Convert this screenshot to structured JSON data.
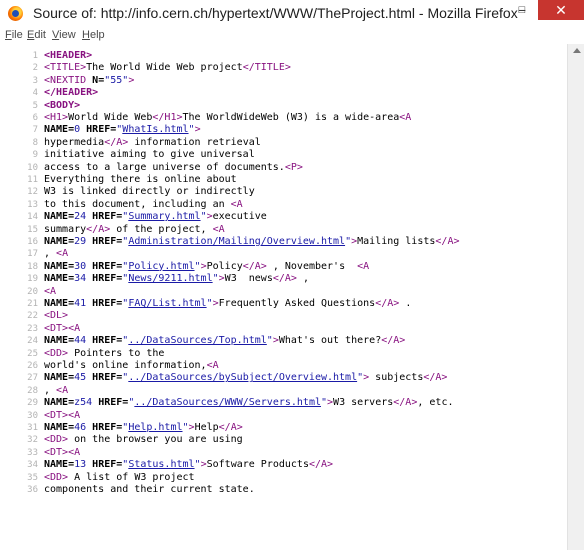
{
  "window": {
    "title": "Source of: http://info.cern.ch/hypertext/WWW/TheProject.html - Mozilla Firefox",
    "minimize": "−",
    "maximize": "□",
    "close": "✕"
  },
  "menu": [
    {
      "label": "File",
      "underline": "F"
    },
    {
      "label": "Edit",
      "underline": "E"
    },
    {
      "label": "View",
      "underline": "V"
    },
    {
      "label": "Help",
      "underline": "H"
    }
  ],
  "lines": [
    [
      [
        "tagb",
        "<HEADER>"
      ]
    ],
    [
      [
        "tag",
        "<TITLE"
      ],
      [
        "tag",
        ">"
      ],
      [
        "t",
        "The World Wide Web project"
      ],
      [
        "tag",
        "</TITLE>"
      ]
    ],
    [
      [
        "tag",
        "<NEXTID "
      ],
      [
        "an",
        "N="
      ],
      [
        "av",
        "\"55\""
      ],
      [
        "tag",
        ">"
      ]
    ],
    [
      [
        "tagb",
        "</HEADER>"
      ]
    ],
    [
      [
        "tagb",
        "<BODY>"
      ]
    ],
    [
      [
        "tag",
        "<H1>"
      ],
      [
        "t",
        "World Wide Web"
      ],
      [
        "tag",
        "</H1>"
      ],
      [
        "t",
        "The WorldWideWeb (W3) is a wide-area"
      ],
      [
        "tag",
        "<A"
      ]
    ],
    [
      [
        "an",
        "NAME="
      ],
      [
        "av",
        "0 "
      ],
      [
        "an",
        "HREF="
      ],
      [
        "av",
        "\""
      ],
      [
        "link",
        "WhatIs.html"
      ],
      [
        "av",
        "\""
      ],
      [
        "tag",
        ">"
      ]
    ],
    [
      [
        "t",
        "hypermedia"
      ],
      [
        "tag",
        "</A>"
      ],
      [
        "t",
        " information retrieval"
      ]
    ],
    [
      [
        "t",
        "initiative aiming to give universal"
      ]
    ],
    [
      [
        "t",
        "access to a large universe of documents."
      ],
      [
        "tag",
        "<P>"
      ]
    ],
    [
      [
        "t",
        "Everything there is online about"
      ]
    ],
    [
      [
        "t",
        "W3 is linked directly or indirectly"
      ]
    ],
    [
      [
        "t",
        "to this document, including an "
      ],
      [
        "tag",
        "<A"
      ]
    ],
    [
      [
        "an",
        "NAME="
      ],
      [
        "av",
        "24 "
      ],
      [
        "an",
        "HREF="
      ],
      [
        "av",
        "\""
      ],
      [
        "link",
        "Summary.html"
      ],
      [
        "av",
        "\""
      ],
      [
        "tag",
        ">"
      ],
      [
        "t",
        "executive"
      ]
    ],
    [
      [
        "t",
        "summary"
      ],
      [
        "tag",
        "</A>"
      ],
      [
        "t",
        " of the project, "
      ],
      [
        "tag",
        "<A"
      ]
    ],
    [
      [
        "an",
        "NAME="
      ],
      [
        "av",
        "29 "
      ],
      [
        "an",
        "HREF="
      ],
      [
        "av",
        "\""
      ],
      [
        "link",
        "Administration/Mailing/Overview.html"
      ],
      [
        "av",
        "\""
      ],
      [
        "tag",
        ">"
      ],
      [
        "t",
        "Mailing lists"
      ],
      [
        "tag",
        "</A>"
      ]
    ],
    [
      [
        "t",
        ", "
      ],
      [
        "tag",
        "<A"
      ]
    ],
    [
      [
        "an",
        "NAME="
      ],
      [
        "av",
        "30 "
      ],
      [
        "an",
        "HREF="
      ],
      [
        "av",
        "\""
      ],
      [
        "link",
        "Policy.html"
      ],
      [
        "av",
        "\""
      ],
      [
        "tag",
        ">"
      ],
      [
        "t",
        "Policy"
      ],
      [
        "tag",
        "</A>"
      ],
      [
        "t",
        " , November's  "
      ],
      [
        "tag",
        "<A"
      ]
    ],
    [
      [
        "an",
        "NAME="
      ],
      [
        "av",
        "34 "
      ],
      [
        "an",
        "HREF="
      ],
      [
        "av",
        "\""
      ],
      [
        "link",
        "News/9211.html"
      ],
      [
        "av",
        "\""
      ],
      [
        "tag",
        ">"
      ],
      [
        "t",
        "W3  news"
      ],
      [
        "tag",
        "</A>"
      ],
      [
        "t",
        " ,"
      ]
    ],
    [
      [
        "tag",
        "<A"
      ]
    ],
    [
      [
        "an",
        "NAME="
      ],
      [
        "av",
        "41 "
      ],
      [
        "an",
        "HREF="
      ],
      [
        "av",
        "\""
      ],
      [
        "link",
        "FAQ/List.html"
      ],
      [
        "av",
        "\""
      ],
      [
        "tag",
        ">"
      ],
      [
        "t",
        "Frequently Asked Questions"
      ],
      [
        "tag",
        "</A>"
      ],
      [
        "t",
        " ."
      ]
    ],
    [
      [
        "tag",
        "<DL>"
      ]
    ],
    [
      [
        "tag",
        "<DT>"
      ],
      [
        "tag",
        "<A"
      ]
    ],
    [
      [
        "an",
        "NAME="
      ],
      [
        "av",
        "44 "
      ],
      [
        "an",
        "HREF="
      ],
      [
        "av",
        "\""
      ],
      [
        "link",
        "../DataSources/Top.html"
      ],
      [
        "av",
        "\""
      ],
      [
        "tag",
        ">"
      ],
      [
        "t",
        "What's out there?"
      ],
      [
        "tag",
        "</A>"
      ]
    ],
    [
      [
        "tag",
        "<DD>"
      ],
      [
        "t",
        " Pointers to the"
      ]
    ],
    [
      [
        "t",
        "world's online information,"
      ],
      [
        "tag",
        "<A"
      ]
    ],
    [
      [
        "an",
        "NAME="
      ],
      [
        "av",
        "45 "
      ],
      [
        "an",
        "HREF="
      ],
      [
        "av",
        "\""
      ],
      [
        "link",
        "../DataSources/bySubject/Overview.html"
      ],
      [
        "av",
        "\""
      ],
      [
        "tag",
        ">"
      ],
      [
        "t",
        " subjects"
      ],
      [
        "tag",
        "</A>"
      ]
    ],
    [
      [
        "t",
        ", "
      ],
      [
        "tag",
        "<A"
      ]
    ],
    [
      [
        "an",
        "NAME="
      ],
      [
        "av",
        "z54 "
      ],
      [
        "an",
        "HREF="
      ],
      [
        "av",
        "\""
      ],
      [
        "link",
        "../DataSources/WWW/Servers.html"
      ],
      [
        "av",
        "\""
      ],
      [
        "tag",
        ">"
      ],
      [
        "t",
        "W3 servers"
      ],
      [
        "tag",
        "</A>"
      ],
      [
        "t",
        ", etc."
      ]
    ],
    [
      [
        "tag",
        "<DT>"
      ],
      [
        "tag",
        "<A"
      ]
    ],
    [
      [
        "an",
        "NAME="
      ],
      [
        "av",
        "46 "
      ],
      [
        "an",
        "HREF="
      ],
      [
        "av",
        "\""
      ],
      [
        "link",
        "Help.html"
      ],
      [
        "av",
        "\""
      ],
      [
        "tag",
        ">"
      ],
      [
        "t",
        "Help"
      ],
      [
        "tag",
        "</A>"
      ]
    ],
    [
      [
        "tag",
        "<DD>"
      ],
      [
        "t",
        " on the browser you are using"
      ]
    ],
    [
      [
        "tag",
        "<DT>"
      ],
      [
        "tag",
        "<A"
      ]
    ],
    [
      [
        "an",
        "NAME="
      ],
      [
        "av",
        "13 "
      ],
      [
        "an",
        "HREF="
      ],
      [
        "av",
        "\""
      ],
      [
        "link",
        "Status.html"
      ],
      [
        "av",
        "\""
      ],
      [
        "tag",
        ">"
      ],
      [
        "t",
        "Software Products"
      ],
      [
        "tag",
        "</A>"
      ]
    ],
    [
      [
        "tag",
        "<DD>"
      ],
      [
        "t",
        " A list of W3 project"
      ]
    ],
    [
      [
        "t",
        "components and their current state."
      ]
    ]
  ]
}
